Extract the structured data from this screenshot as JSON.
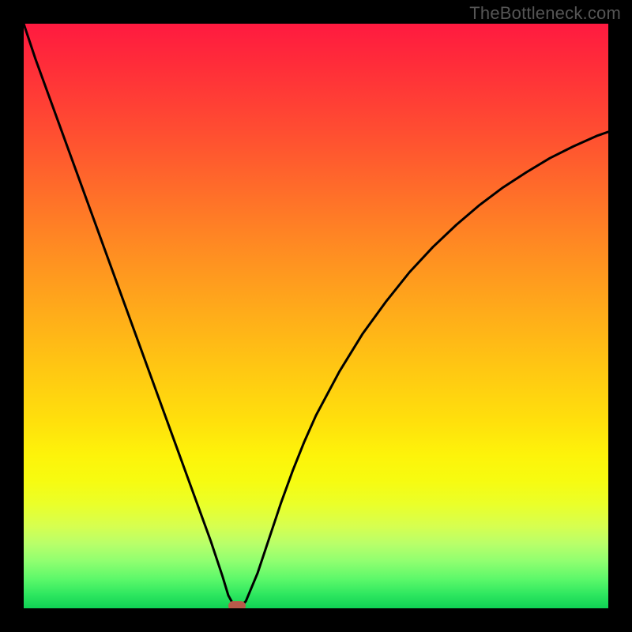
{
  "watermark": "TheBottleneck.com",
  "colors": {
    "frame_bg": "#000000",
    "curve_stroke": "#000000",
    "marker_fill": "#b85a4a",
    "gradient_top": "#ff1a40",
    "gradient_bottom": "#0fd154"
  },
  "chart_data": {
    "type": "line",
    "title": "",
    "xlabel": "",
    "ylabel": "",
    "x_range": [
      0,
      100
    ],
    "y_range": [
      0,
      100
    ],
    "x": [
      0,
      2,
      4,
      6,
      8,
      10,
      12,
      14,
      16,
      18,
      20,
      22,
      24,
      26,
      28,
      30,
      32,
      34,
      35,
      36,
      37,
      38,
      40,
      42,
      44,
      46,
      48,
      50,
      54,
      58,
      62,
      66,
      70,
      74,
      78,
      82,
      86,
      90,
      94,
      98,
      100
    ],
    "y": [
      100,
      94,
      88.5,
      83,
      77.5,
      72,
      66.5,
      61,
      55.5,
      50,
      44.5,
      39,
      33.5,
      28,
      22.5,
      17,
      11.5,
      5.5,
      2.2,
      0.4,
      0.2,
      1.2,
      6,
      12,
      18,
      23.5,
      28.5,
      33,
      40.5,
      47,
      52.5,
      57.5,
      61.8,
      65.6,
      69,
      72,
      74.6,
      77,
      79,
      80.8,
      81.5
    ],
    "grid": false,
    "legend": false,
    "annotations": [
      {
        "type": "marker",
        "x": 36.5,
        "y": 0,
        "shape": "rounded-rect",
        "color": "#b85a4a"
      }
    ]
  }
}
